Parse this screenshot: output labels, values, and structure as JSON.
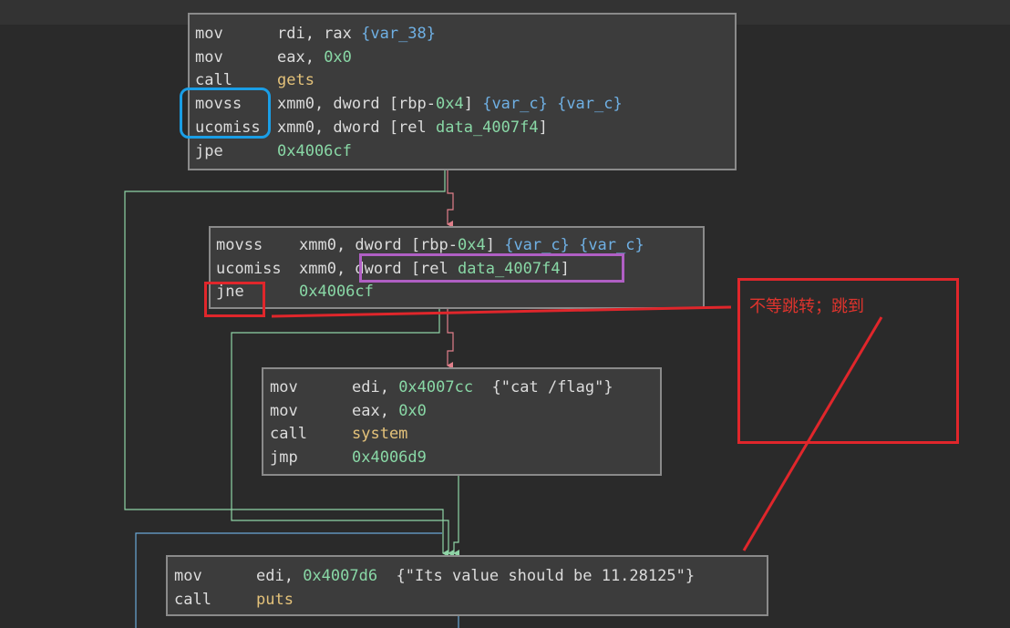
{
  "blocks": {
    "b1": {
      "lines": [
        {
          "mnemonic": "mov",
          "operands": [
            {
              "t": "rdi, rax ",
              "c": "plain"
            },
            {
              "t": "{var_38}",
              "c": "var"
            }
          ]
        },
        {
          "mnemonic": "mov",
          "operands": [
            {
              "t": "eax, ",
              "c": "plain"
            },
            {
              "t": "0x0",
              "c": "num"
            }
          ]
        },
        {
          "mnemonic": "call",
          "operands": [
            {
              "t": "gets",
              "c": "sym"
            }
          ]
        },
        {
          "mnemonic": "movss",
          "operands": [
            {
              "t": "xmm0, dword [rbp-",
              "c": "plain"
            },
            {
              "t": "0x4",
              "c": "num"
            },
            {
              "t": "] ",
              "c": "plain"
            },
            {
              "t": "{var_c} {var_c}",
              "c": "var"
            }
          ]
        },
        {
          "mnemonic": "ucomiss",
          "operands": [
            {
              "t": "xmm0, dword [rel ",
              "c": "plain"
            },
            {
              "t": "data_4007f4",
              "c": "num"
            },
            {
              "t": "]",
              "c": "plain"
            }
          ]
        },
        {
          "mnemonic": "jpe",
          "operands": [
            {
              "t": "0x4006cf",
              "c": "num"
            }
          ]
        }
      ]
    },
    "b2": {
      "lines": [
        {
          "mnemonic": "movss",
          "operands": [
            {
              "t": "xmm0, dword [rbp-",
              "c": "plain"
            },
            {
              "t": "0x4",
              "c": "num"
            },
            {
              "t": "] ",
              "c": "plain"
            },
            {
              "t": "{var_c} {var_c}",
              "c": "var"
            }
          ]
        },
        {
          "mnemonic": "ucomiss",
          "operands": [
            {
              "t": "xmm0, dword [rel ",
              "c": "plain"
            },
            {
              "t": "data_4007f4",
              "c": "num"
            },
            {
              "t": "]",
              "c": "plain"
            }
          ]
        },
        {
          "mnemonic": "jne",
          "operands": [
            {
              "t": "0x4006cf",
              "c": "num"
            }
          ]
        }
      ]
    },
    "b3": {
      "lines": [
        {
          "mnemonic": "mov",
          "operands": [
            {
              "t": "edi, ",
              "c": "plain"
            },
            {
              "t": "0x4007cc",
              "c": "num"
            },
            {
              "t": "  {\"cat /flag\"}",
              "c": "plain"
            }
          ]
        },
        {
          "mnemonic": "mov",
          "operands": [
            {
              "t": "eax, ",
              "c": "plain"
            },
            {
              "t": "0x0",
              "c": "num"
            }
          ]
        },
        {
          "mnemonic": "call",
          "operands": [
            {
              "t": "system",
              "c": "sym"
            }
          ]
        },
        {
          "mnemonic": "jmp",
          "operands": [
            {
              "t": "0x4006d9",
              "c": "num"
            }
          ]
        }
      ]
    },
    "b4": {
      "lines": [
        {
          "mnemonic": "mov",
          "operands": [
            {
              "t": "edi, ",
              "c": "plain"
            },
            {
              "t": "0x4007d6",
              "c": "num"
            },
            {
              "t": "  {\"Its value should be 11.28125\"}",
              "c": "plain"
            }
          ]
        },
        {
          "mnemonic": "call",
          "operands": [
            {
              "t": "puts",
              "c": "sym"
            }
          ]
        }
      ]
    }
  },
  "annotation": {
    "text": "不等跳转；跳到",
    "color": "#e0342d"
  },
  "colors": {
    "edge_true": "#8fd4a6",
    "edge_false": "#e07f8a",
    "edge_uncond": "#6aa8d8",
    "mark_blue": "#1a9ee6",
    "mark_purple": "#b05fc4"
  }
}
